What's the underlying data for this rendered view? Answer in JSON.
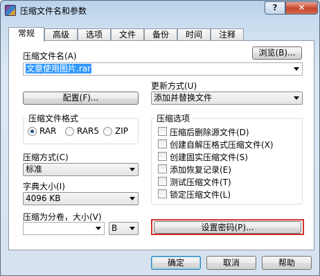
{
  "window": {
    "title": "压缩文件名和参数",
    "help_label": "?",
    "close_label": "✕"
  },
  "tabs": [
    "常规",
    "高级",
    "选项",
    "文件",
    "备份",
    "时间",
    "注释"
  ],
  "general": {
    "archive_name_label": "压缩文件名(A)",
    "browse_label": "浏览(B)...",
    "archive_name_value": "文章使用图片.rar",
    "update_mode_label": "更新方式(U)",
    "update_mode_value": "添加并替换文件",
    "profiles_label": "配置(F)...",
    "format_group_label": "压缩文件格式",
    "format_options": [
      "RAR",
      "RAR5",
      "ZIP"
    ],
    "format_selected": "RAR",
    "method_label": "压缩方式(C)",
    "method_value": "标准",
    "dict_label": "字典大小(I)",
    "dict_value": "4096 KB",
    "split_label": "压缩为分卷，大小(V)",
    "split_value": "",
    "split_unit": "B",
    "options_group_label": "压缩选项",
    "options": [
      {
        "label": "压缩后删除源文件(D)",
        "checked": false
      },
      {
        "label": "创建自解压格式压缩文件(X)",
        "checked": false
      },
      {
        "label": "创建固实压缩文件(S)",
        "checked": false
      },
      {
        "label": "添加恢复记录(E)",
        "checked": false
      },
      {
        "label": "测试压缩文件(T)",
        "checked": false
      },
      {
        "label": "锁定压缩文件(L)",
        "checked": false
      }
    ],
    "password_label": "设置密码(P)..."
  },
  "footer": {
    "ok_label": "确定",
    "cancel_label": "取消",
    "help_label": "帮助"
  },
  "colors": {
    "highlight": "#d0312d",
    "selection": "#3399ff"
  }
}
